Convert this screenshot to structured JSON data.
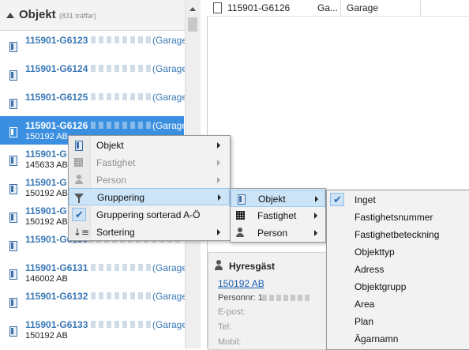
{
  "list": {
    "title": "Objekt",
    "count": "(831 träffar)",
    "rows": [
      {
        "code": "115901-G6123",
        "suffix": "(Garage",
        "sub": ""
      },
      {
        "code": "115901-G6124",
        "suffix": "(Garage",
        "sub": ""
      },
      {
        "code": "115901-G6125",
        "suffix": "(Garage",
        "sub": ""
      },
      {
        "code": "115901-G6126",
        "suffix": "(Garage",
        "sub": "150192 AB"
      },
      {
        "code": "115901-G",
        "suffix": "",
        "sub": "145633 AB"
      },
      {
        "code": "115901-G",
        "suffix": "",
        "sub": "150192 AB"
      },
      {
        "code": "115901-G",
        "suffix": "",
        "sub": "150192 AB"
      },
      {
        "code": "115901-G6130",
        "suffix": "",
        "sub": ""
      },
      {
        "code": "115901-G6131",
        "suffix": "(Garage",
        "sub": "146002 AB"
      },
      {
        "code": "115901-G6132",
        "suffix": "(Garage",
        "sub": ""
      },
      {
        "code": "115901-G6133",
        "suffix": "(Garage",
        "sub": "150192 AB"
      }
    ]
  },
  "table_row": {
    "code": "115901-G6126",
    "col2": "Ga...",
    "col3": "Garage"
  },
  "tenant": {
    "title": "Hyresgäst",
    "link": "150192 AB",
    "personnr_label": "Personnr: 1",
    "email_label": "E-post:",
    "phone_label": "Tel:",
    "mobile_label": "Mobil:"
  },
  "menu1": {
    "items": [
      {
        "label": "Objekt",
        "icon": "document-icon",
        "disabled": false
      },
      {
        "label": "Fastighet",
        "icon": "building-icon",
        "disabled": true
      },
      {
        "label": "Person",
        "icon": "person-icon",
        "disabled": true
      },
      {
        "label": "Gruppering",
        "icon": "funnel-icon",
        "disabled": false,
        "highlighted": true
      },
      {
        "label": "Gruppering sorterad A-Ö",
        "icon": "check-icon",
        "disabled": false
      },
      {
        "label": "Sortering",
        "icon": "sort-icon",
        "disabled": false
      }
    ]
  },
  "menu2": {
    "items": [
      {
        "label": "Objekt",
        "icon": "document-icon",
        "highlighted": true
      },
      {
        "label": "Fastighet",
        "icon": "building-icon"
      },
      {
        "label": "Person",
        "icon": "person-icon"
      }
    ]
  },
  "menu3": {
    "items": [
      {
        "label": "Inget",
        "checked": true
      },
      {
        "label": "Fastighetsnummer"
      },
      {
        "label": "Fastighetbeteckning"
      },
      {
        "label": "Objekttyp"
      },
      {
        "label": "Adress"
      },
      {
        "label": "Objektgrupp"
      },
      {
        "label": "Area"
      },
      {
        "label": "Plan"
      },
      {
        "label": "Ägarnamn"
      }
    ]
  },
  "colors": {
    "accent": "#3b8fe0",
    "link": "#3a78b5",
    "menu_highlight": "#cce4f7"
  }
}
